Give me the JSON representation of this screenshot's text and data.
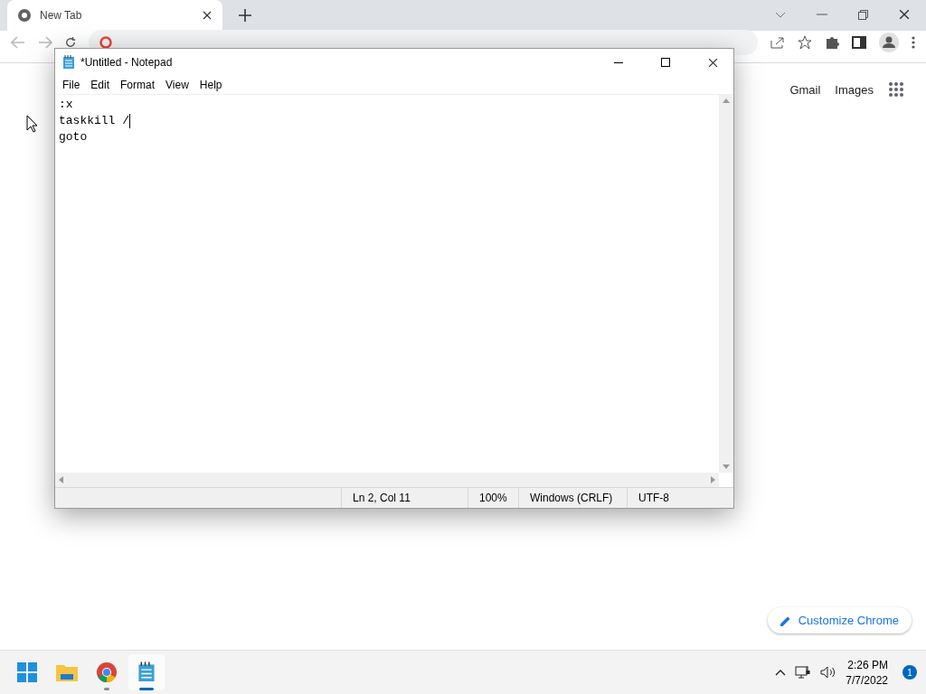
{
  "browser": {
    "tab": {
      "title": "New Tab",
      "selected": true
    },
    "links": [
      "Gmail",
      "Images"
    ],
    "customize_button": "Customize Chrome"
  },
  "notepad": {
    "title": "*Untitled - Notepad",
    "menu": [
      "File",
      "Edit",
      "Format",
      "View",
      "Help"
    ],
    "lines": [
      {
        "text": ":x",
        "caret": false
      },
      {
        "text": "taskkill /",
        "caret": true
      },
      {
        "text": "goto",
        "caret": false
      }
    ],
    "status_bar": [
      "Ln 2, Col 11",
      "100%",
      "Windows (CRLF)",
      "UTF-8"
    ]
  },
  "taskbar": {
    "apps": [
      {
        "kind": "start"
      },
      {
        "kind": "explorer"
      },
      {
        "kind": "chrome",
        "active": false,
        "running": true
      },
      {
        "kind": "notepad",
        "active": true,
        "running": true
      }
    ],
    "time": "2:26 PM",
    "date": "7/7/2022",
    "notifications": "1"
  }
}
